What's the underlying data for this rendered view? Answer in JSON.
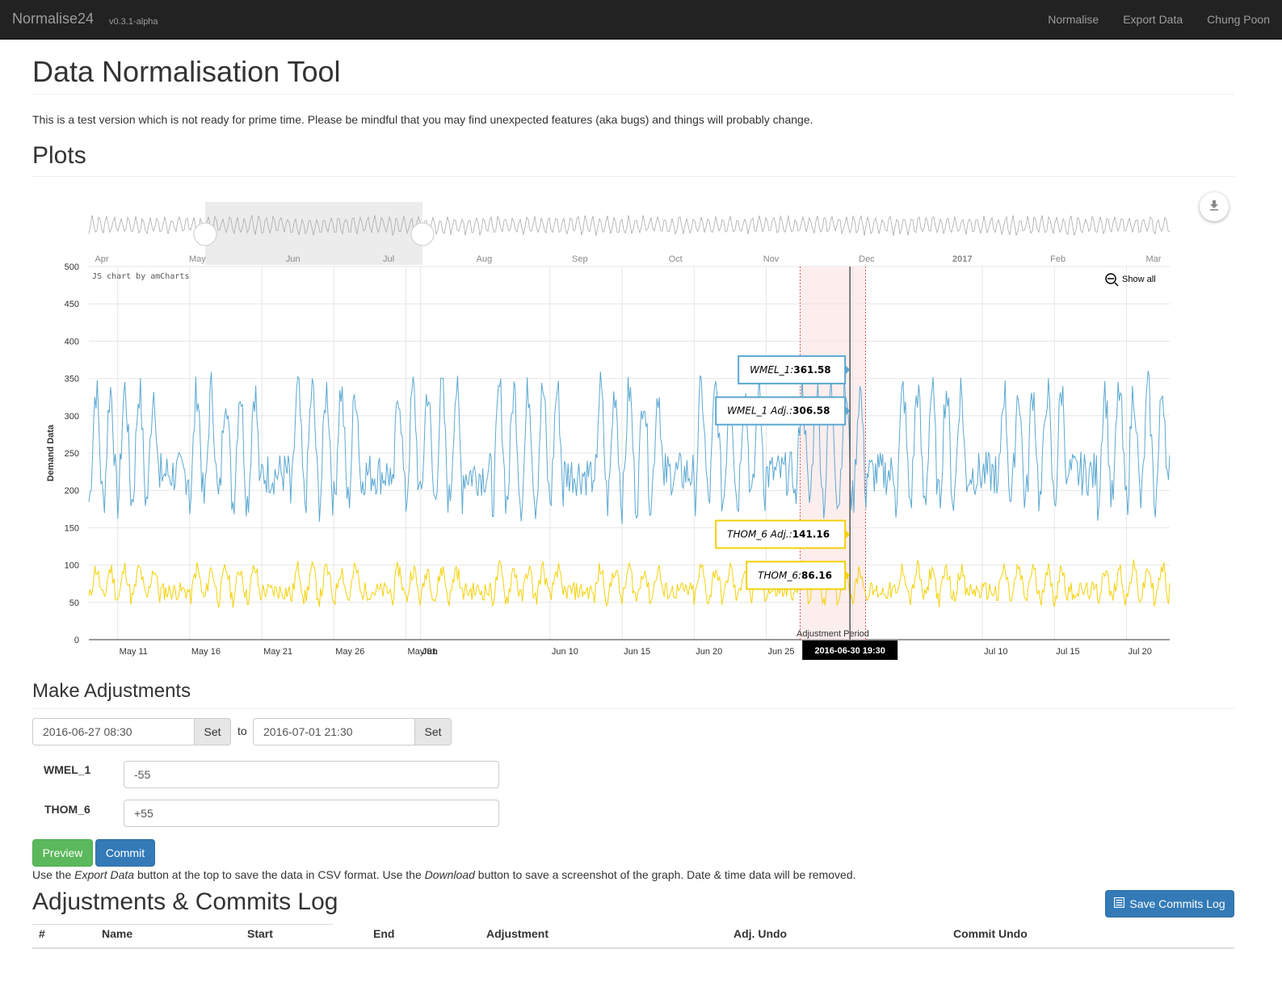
{
  "navbar": {
    "brand": "Normalise24",
    "version": "v0.3.1-alpha",
    "links": [
      "Normalise",
      "Export Data",
      "Chung Poon"
    ]
  },
  "page": {
    "title": "Data Normalisation Tool",
    "intro": "This is a test version which is not ready for prime time. Please be mindful that you may find unexpected features (aka bugs) and things will probably change."
  },
  "plots": {
    "heading": "Plots",
    "credit": "JS chart by amCharts",
    "show_all": "Show all",
    "download_icon": "download-icon"
  },
  "chart_data": {
    "type": "line",
    "ylabel": "Demand Data",
    "xlabel": "",
    "ylim": [
      0,
      500
    ],
    "y_ticks": [
      0,
      50,
      100,
      150,
      200,
      250,
      300,
      350,
      400,
      450,
      500
    ],
    "x_range": [
      "2016-05-09",
      "2016-07-23"
    ],
    "x_ticks": [
      {
        "label": "May 11",
        "date": "2016-05-11",
        "bold": false
      },
      {
        "label": "May 16",
        "date": "2016-05-16",
        "bold": false
      },
      {
        "label": "May 21",
        "date": "2016-05-21",
        "bold": false
      },
      {
        "label": "May 26",
        "date": "2016-05-26",
        "bold": false
      },
      {
        "label": "May 31",
        "date": "2016-05-31",
        "bold": false
      },
      {
        "label": "Jun",
        "date": "2016-06-01",
        "bold": true
      },
      {
        "label": "Jun 10",
        "date": "2016-06-10",
        "bold": false
      },
      {
        "label": "Jun 15",
        "date": "2016-06-15",
        "bold": false
      },
      {
        "label": "Jun 20",
        "date": "2016-06-20",
        "bold": false
      },
      {
        "label": "Jun 25",
        "date": "2016-06-25",
        "bold": false
      },
      {
        "label": "Jul",
        "date": "2016-07-01",
        "bold": true
      },
      {
        "label": "Jul 10",
        "date": "2016-07-10",
        "bold": false
      },
      {
        "label": "Jul 15",
        "date": "2016-07-15",
        "bold": false
      },
      {
        "label": "Jul 20",
        "date": "2016-07-20",
        "bold": false
      }
    ],
    "scrollbar_ticks": [
      {
        "label": "Apr",
        "bold": false
      },
      {
        "label": "May",
        "bold": false
      },
      {
        "label": "Jun",
        "bold": false
      },
      {
        "label": "Jul",
        "bold": false
      },
      {
        "label": "Aug",
        "bold": false
      },
      {
        "label": "Sep",
        "bold": false
      },
      {
        "label": "Oct",
        "bold": false
      },
      {
        "label": "Nov",
        "bold": false
      },
      {
        "label": "Dec",
        "bold": false
      },
      {
        "label": "2017",
        "bold": true
      },
      {
        "label": "Feb",
        "bold": false
      },
      {
        "label": "Mar",
        "bold": false
      }
    ],
    "series": [
      {
        "name": "WMEL_1",
        "color": "#5ba8d2",
        "daily_peak": 335,
        "daily_trough": 185,
        "tooltip": "361.58"
      },
      {
        "name": "WMEL_1 Adj.",
        "color": "#5ba8d2",
        "tooltip": "306.58"
      },
      {
        "name": "THOM_6 Adj.",
        "color": "#f5d10a",
        "tooltip": "141.16"
      },
      {
        "name": "THOM_6",
        "color": "#f5d10a",
        "daily_peak": 95,
        "daily_trough": 55,
        "tooltip": "86.16"
      }
    ],
    "adjustment_period": {
      "label": "Adjustment Period",
      "start": "2016-06-27 08:30",
      "end": "2016-07-01 21:30"
    },
    "cursor": {
      "label": "2016-06-30 19:30",
      "date": "2016-06-30 19:30"
    },
    "grid": true
  },
  "adjustments": {
    "heading": "Make Adjustments",
    "start_value": "2016-06-27 08:30",
    "end_value": "2016-07-01 21:30",
    "set_label": "Set",
    "to_label": "to",
    "fields": [
      {
        "label": "WMEL_1",
        "value": "-55"
      },
      {
        "label": "THOM_6",
        "value": "+55"
      }
    ],
    "preview_label": "Preview",
    "commit_label": "Commit",
    "help_parts": [
      "Use the ",
      "Export Data",
      " button at the top to save the data in CSV format. Use the ",
      "Download",
      " button to save a screenshot of the graph. Date & time data will be removed."
    ]
  },
  "log": {
    "heading": "Adjustments & Commits Log",
    "save_label": "Save Commits Log",
    "save_icon": "list-icon",
    "columns": [
      "#",
      "Name",
      "Start",
      "End",
      "Adjustment",
      "Adj. Undo",
      "Commit Undo"
    ]
  },
  "colors": {
    "navbar": "#222222",
    "primary": "#337ab7",
    "success": "#5cb85c",
    "series_blue": "#5ba8d2",
    "series_yellow": "#f5d10a",
    "adjustment_band": "#fbe3e3"
  }
}
